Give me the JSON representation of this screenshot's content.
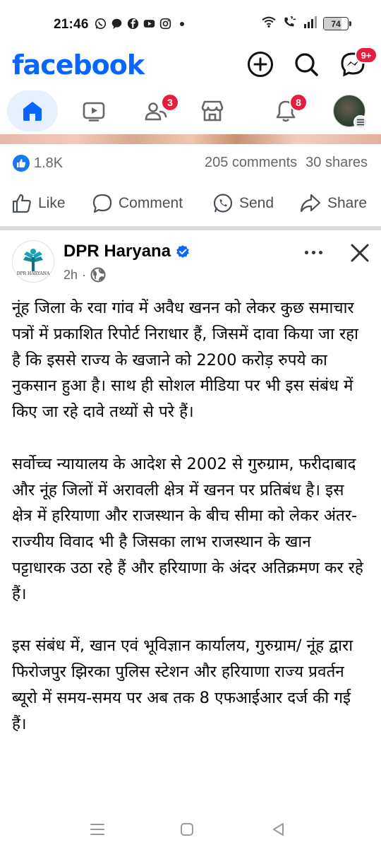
{
  "status_bar": {
    "time": "21:46",
    "battery": "74",
    "battery_level_pct": 74,
    "app_icons": [
      "whatsapp-icon",
      "chat-bubble-icon",
      "facebook-icon",
      "youtube-icon",
      "instagram-icon",
      "more-dot-icon"
    ],
    "right_icons": [
      "wifi-icon",
      "volte-call-icon",
      "signal-icon",
      "battery-icon"
    ]
  },
  "header": {
    "logo": "facebook",
    "messenger_badge": "9+",
    "brand_color": "#0866ff"
  },
  "nav": {
    "items": [
      {
        "name": "home",
        "icon": "home-icon",
        "active": true
      },
      {
        "name": "video",
        "icon": "video-icon"
      },
      {
        "name": "friends",
        "icon": "friends-icon",
        "badge": "3"
      },
      {
        "name": "marketplace",
        "icon": "marketplace-icon"
      },
      {
        "name": "notifications",
        "icon": "bell-icon",
        "badge": "8"
      },
      {
        "name": "profile",
        "icon": "profile-avatar"
      }
    ],
    "badge_color": "#e41e3f"
  },
  "engagement": {
    "likes": "1.8K",
    "comments": "205 comments",
    "shares": "30 shares"
  },
  "actions": {
    "like": "Like",
    "comment": "Comment",
    "send": "Send",
    "share": "Share"
  },
  "post": {
    "page_name": "DPR Haryana",
    "page_logo_text": "DPR HARYANA",
    "verified": true,
    "time": "2h",
    "privacy_icon": "globe-icon",
    "paragraphs": [
      "नूंह जिला के रवा गांव में अवैध खनन को लेकर कुछ समाचार पत्रों में प्रकाशित रिपोर्ट निराधार हैं, जिसमें दावा किया जा रहा है कि इससे राज्य के खजाने को 2200 करोड़ रुपये का नुकसान हुआ है। साथ ही सोशल मीडिया पर भी इस संबंध में किए जा रहे दावे तथ्यों से परे हैं।",
      "सर्वोच्च न्यायालय के आदेश से 2002 से गुरुग्राम, फरीदाबाद और नूंह जिलों में अरावली क्षेत्र में खनन पर प्रतिबंध है। इस क्षेत्र में हरियाणा और राजस्थान के बीच सीमा को लेकर अंतर-राज्यीय विवाद भी है जिसका लाभ राजस्थान के खान पट्टाधारक उठा रहे हैं और हरियाणा के अंदर अतिक्रमण कर रहे हैं।",
      "इस संबंध में, खान एवं भूविज्ञान कार्यालय, गुरुग्राम/ नूंह द्वारा फिरोजपुर झिरका पुलिस स्टेशन और हरियाणा राज्य प्रवर्तन ब्यूरो में समय-समय पर अब तक 8 एफआईआर दर्ज की गई हैं।"
    ]
  },
  "system_nav": {
    "icons": [
      "menu-icon",
      "home-square-icon",
      "back-triangle-icon"
    ]
  }
}
